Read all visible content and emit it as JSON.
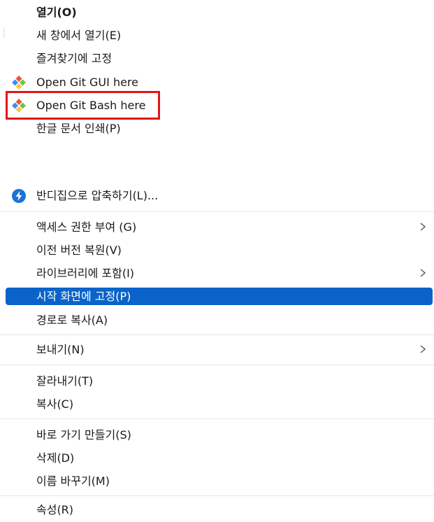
{
  "menu": {
    "open": "열기(O)",
    "open_new_window": "새 창에서 열기(E)",
    "pin_favorites": "즐겨찾기에 고정",
    "git_gui": "Open Git GUI here",
    "git_bash": "Open Git Bash here",
    "hangul_print": "한글 문서 인쇄(P)",
    "bandizip": "반디집으로 압축하기(L)...",
    "grant_access": "액세스 권한 부여 (G)",
    "restore_version": "이전 버전 복원(V)",
    "include_library": "라이브러리에 포함(I)",
    "pin_start": "시작 화면에 고정(P)",
    "copy_path": "경로로 복사(A)",
    "send_to": "보내기(N)",
    "cut": "잘라내기(T)",
    "copy": "복사(C)",
    "create_shortcut": "바로 가기 만들기(S)",
    "delete": "삭제(D)",
    "rename": "이름 바꾸기(M)",
    "properties": "속성(R)"
  },
  "icons": {
    "git": "git-diamond-icon",
    "bandizip": "bandizip-lightning-icon",
    "submenu": "chevron-right-icon"
  },
  "colors": {
    "highlight": "#0a63c9",
    "callout": "#e01717",
    "bandizip": "#1c72d6"
  }
}
